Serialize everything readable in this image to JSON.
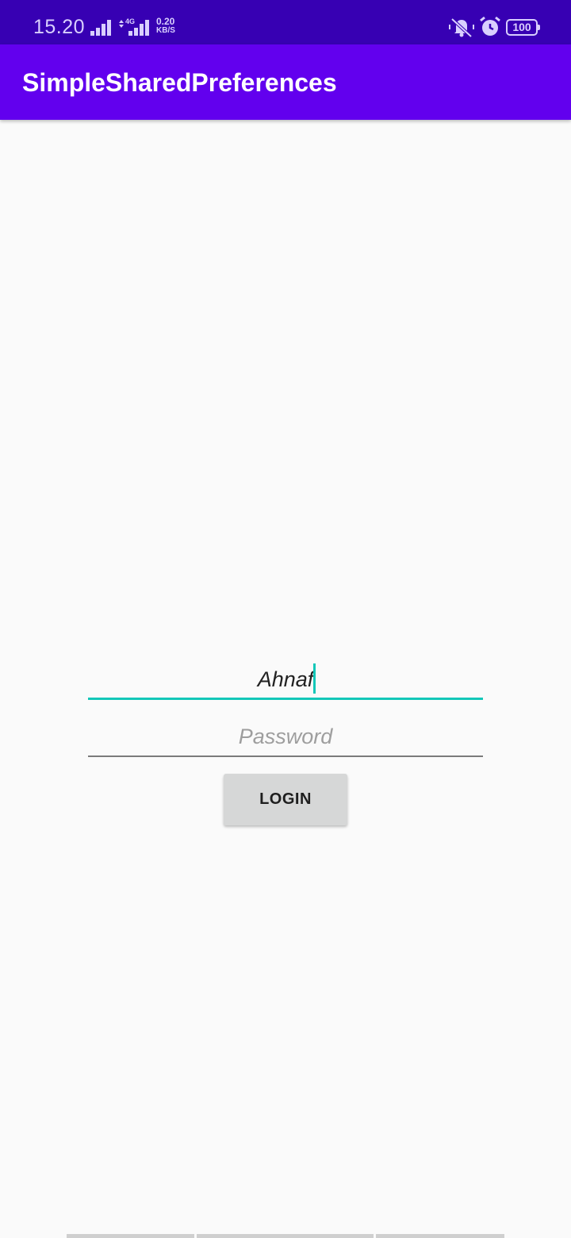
{
  "status_bar": {
    "time": "15.20",
    "network_type": "4G",
    "speed_value": "0.20",
    "speed_unit": "KB/S",
    "battery": "100",
    "icons": [
      "signal-icon",
      "signal-4g-icon",
      "mute-vibrate-icon",
      "alarm-icon",
      "battery-icon"
    ],
    "background": "#3700b3"
  },
  "app_bar": {
    "title": "SimpleSharedPreferences",
    "background": "#6200ee"
  },
  "form": {
    "username_value": "Ahnaf",
    "password_placeholder": "Password",
    "login_label": "LOGIN",
    "accent": "#12c7b8"
  }
}
